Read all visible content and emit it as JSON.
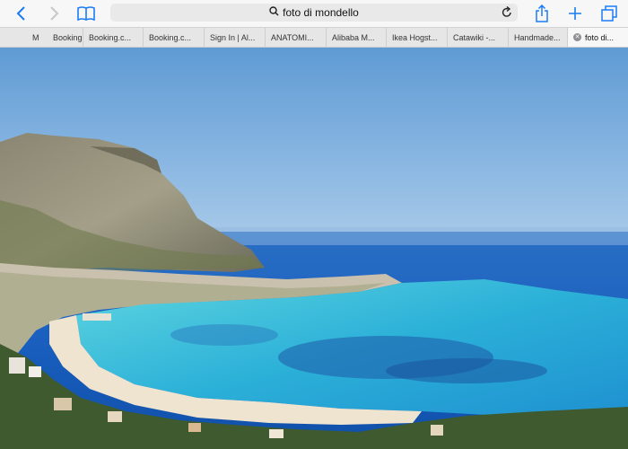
{
  "toolbar": {
    "back_icon": "chevron-left-icon",
    "forward_icon": "chevron-right-icon",
    "bookmarks_icon": "book-icon",
    "share_icon": "share-icon",
    "new_tab_icon": "plus-icon",
    "tabs_icon": "tabs-icon",
    "accent_color": "#1a7cf5"
  },
  "address": {
    "search_icon": "search-icon",
    "query": "foto di mondello",
    "reload_icon": "reload-icon"
  },
  "tabs": [
    {
      "label": "M"
    },
    {
      "label": "Booking"
    },
    {
      "label": "Booking.c..."
    },
    {
      "label": "Booking.c..."
    },
    {
      "label": "Sign In | Al..."
    },
    {
      "label": "ANATOMI..."
    },
    {
      "label": "Alibaba M..."
    },
    {
      "label": "Ikea Hogst..."
    },
    {
      "label": "Catawiki -..."
    },
    {
      "label": "Handmade..."
    },
    {
      "label": "foto di..."
    }
  ],
  "image": {
    "subject": "Mondello bay with Monte Pellegrino, beach and turquoise sea"
  }
}
